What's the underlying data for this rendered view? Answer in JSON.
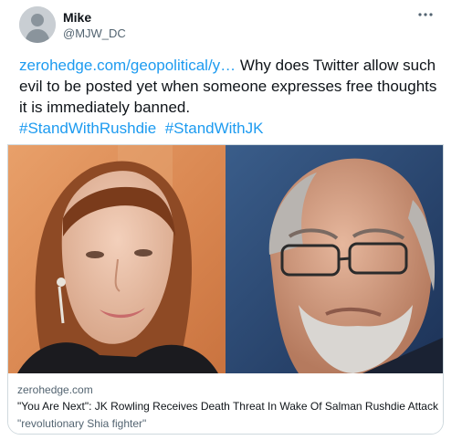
{
  "user": {
    "name": "Mike",
    "handle": "@MJW_DC"
  },
  "tweet": {
    "link_text": "zerohedge.com/geopolitical/y…",
    "body": " Why does Twitter allow such evil to be posted yet when someone expresses free thoughts it is immediately banned.",
    "hashtags": [
      "#StandWithRushdie",
      "#StandWithJK"
    ]
  },
  "card": {
    "domain": "zerohedge.com",
    "title": "\"You Are Next\": JK Rowling Receives Death Threat In Wake Of Salman Rushdie Attack",
    "description": "\"revolutionary Shia fighter\""
  },
  "icons": {
    "avatar": "default-avatar-icon",
    "more": "more-options-icon"
  },
  "colors": {
    "link": "#1d9bf0",
    "text": "#0f1419",
    "secondary": "#536471",
    "border": "#cfd9de"
  }
}
